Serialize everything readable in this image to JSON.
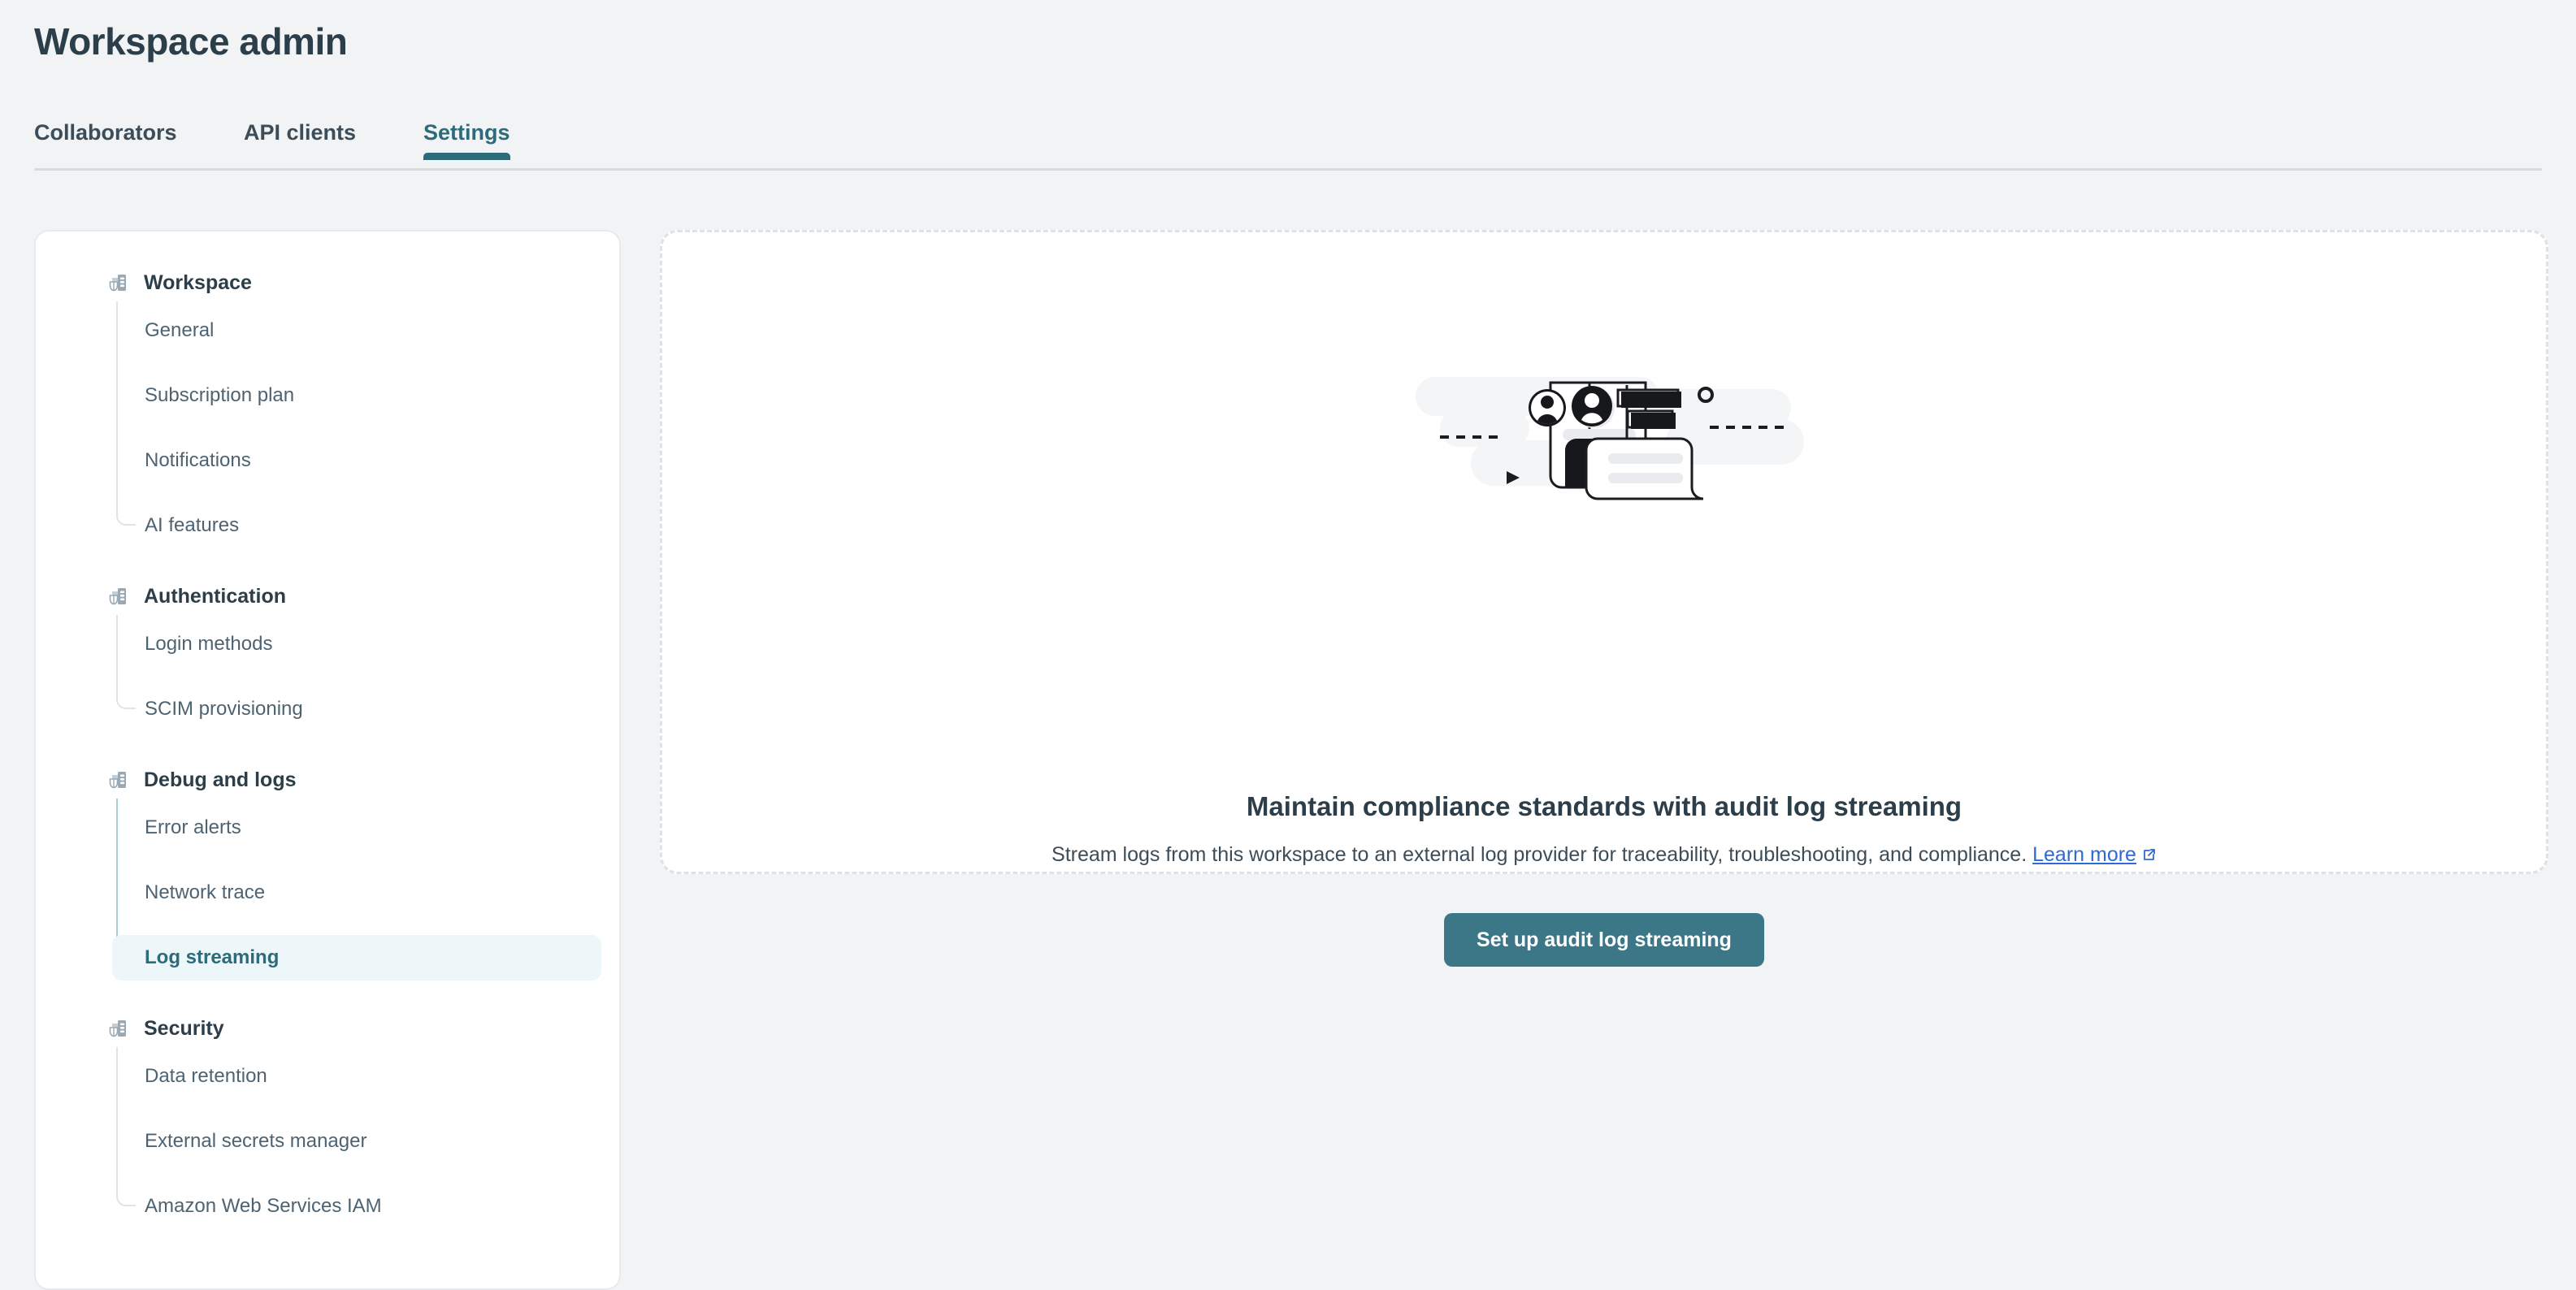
{
  "header": {
    "title": "Workspace admin"
  },
  "tabs": [
    {
      "label": "Collaborators",
      "selected": false
    },
    {
      "label": "API clients",
      "selected": false
    },
    {
      "label": "Settings",
      "selected": true
    }
  ],
  "sidebar": {
    "groups": [
      {
        "label": "Workspace",
        "icon": "workspace-shield-icon",
        "items": [
          {
            "label": "General",
            "selected": false
          },
          {
            "label": "Subscription plan",
            "selected": false
          },
          {
            "label": "Notifications",
            "selected": false
          },
          {
            "label": "AI features",
            "selected": false
          }
        ]
      },
      {
        "label": "Authentication",
        "icon": "workspace-shield-icon",
        "items": [
          {
            "label": "Login methods",
            "selected": false
          },
          {
            "label": "SCIM provisioning",
            "selected": false
          }
        ]
      },
      {
        "label": "Debug and logs",
        "icon": "workspace-shield-icon",
        "items": [
          {
            "label": "Error alerts",
            "selected": false
          },
          {
            "label": "Network trace",
            "selected": false
          },
          {
            "label": "Log streaming",
            "selected": true
          }
        ]
      },
      {
        "label": "Security",
        "icon": "workspace-shield-icon",
        "items": [
          {
            "label": "Data retention",
            "selected": false
          },
          {
            "label": "External secrets manager",
            "selected": false
          },
          {
            "label": "Amazon Web Services IAM",
            "selected": false
          }
        ]
      }
    ]
  },
  "main": {
    "illustration_name": "audit-log-streaming-illustration",
    "headline": "Maintain compliance standards with audit log streaming",
    "subtext": "Stream logs from this workspace to an external log provider for traceability, troubleshooting, and compliance.",
    "learn_more_label": "Learn more",
    "external_link_icon": "external-link-icon",
    "cta_label": "Set up audit log streaming"
  },
  "colors": {
    "page_background": "#f1f3f5",
    "card_background": "#ffffff",
    "accent_teal": "#2b6b7a",
    "button_teal": "#3c7788",
    "selected_item_background": "#edf6f8",
    "link_blue": "#3069d6",
    "heading_text": "#2c3e4a",
    "body_text": "#3c4d59",
    "muted_text": "#4e6372",
    "border": "#e6eaed",
    "dashed_border": "#dde2e6"
  }
}
